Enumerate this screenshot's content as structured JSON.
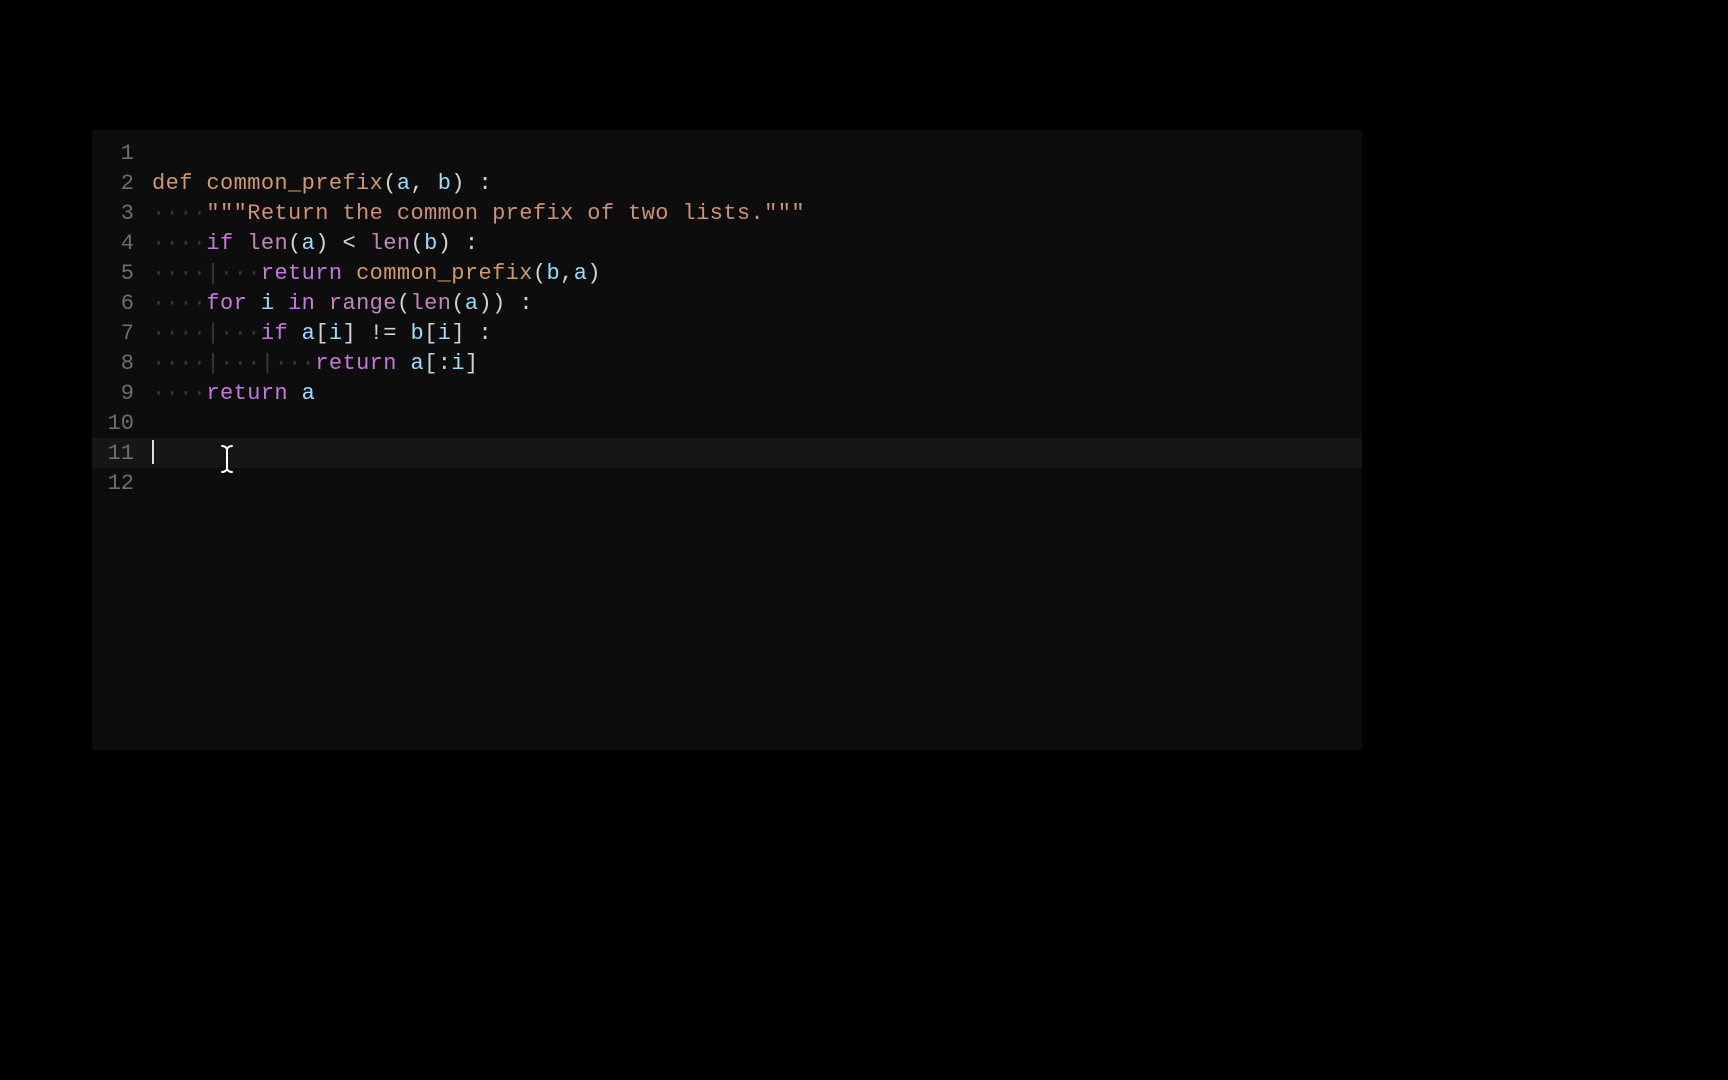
{
  "editor": {
    "cursor_line": 11,
    "lines": [
      {
        "n": 1,
        "tokens": []
      },
      {
        "n": 2,
        "tokens": [
          {
            "t": "def ",
            "c": "kw-def"
          },
          {
            "t": "common_prefix",
            "c": "fn"
          },
          {
            "t": "(",
            "c": "punct"
          },
          {
            "t": "a",
            "c": "param"
          },
          {
            "t": ", ",
            "c": "punct"
          },
          {
            "t": "b",
            "c": "param"
          },
          {
            "t": ") :",
            "c": "punct"
          }
        ]
      },
      {
        "n": 3,
        "tokens": [
          {
            "t": "····",
            "c": "ws-dot"
          },
          {
            "t": "\"\"\"Return the common prefix of two lists.\"\"\"",
            "c": "str"
          }
        ]
      },
      {
        "n": 4,
        "tokens": [
          {
            "t": "····",
            "c": "ws-dot"
          },
          {
            "t": "if ",
            "c": "kw-ctrl"
          },
          {
            "t": "len",
            "c": "builtin"
          },
          {
            "t": "(",
            "c": "punct"
          },
          {
            "t": "a",
            "c": "var"
          },
          {
            "t": ") < ",
            "c": "op"
          },
          {
            "t": "len",
            "c": "builtin"
          },
          {
            "t": "(",
            "c": "punct"
          },
          {
            "t": "b",
            "c": "var"
          },
          {
            "t": ") :",
            "c": "punct"
          }
        ]
      },
      {
        "n": 5,
        "tokens": [
          {
            "t": "····",
            "c": "ws-dot"
          },
          {
            "t": "|",
            "c": "ws-guide"
          },
          {
            "t": "···",
            "c": "ws-dot"
          },
          {
            "t": "return ",
            "c": "kw-ctrl"
          },
          {
            "t": "common_prefix",
            "c": "fn"
          },
          {
            "t": "(",
            "c": "punct"
          },
          {
            "t": "b",
            "c": "var"
          },
          {
            "t": ",",
            "c": "punct"
          },
          {
            "t": "a",
            "c": "var"
          },
          {
            "t": ")",
            "c": "punct"
          }
        ]
      },
      {
        "n": 6,
        "tokens": [
          {
            "t": "····",
            "c": "ws-dot"
          },
          {
            "t": "for ",
            "c": "kw-ctrl"
          },
          {
            "t": "i",
            "c": "var"
          },
          {
            "t": " in ",
            "c": "kw-ctrl"
          },
          {
            "t": "range",
            "c": "builtin"
          },
          {
            "t": "(",
            "c": "punct"
          },
          {
            "t": "len",
            "c": "builtin"
          },
          {
            "t": "(",
            "c": "punct"
          },
          {
            "t": "a",
            "c": "var"
          },
          {
            "t": ")) :",
            "c": "punct"
          }
        ]
      },
      {
        "n": 7,
        "tokens": [
          {
            "t": "····",
            "c": "ws-dot"
          },
          {
            "t": "|",
            "c": "ws-guide"
          },
          {
            "t": "···",
            "c": "ws-dot"
          },
          {
            "t": "if ",
            "c": "kw-ctrl"
          },
          {
            "t": "a",
            "c": "var"
          },
          {
            "t": "[",
            "c": "punct"
          },
          {
            "t": "i",
            "c": "var"
          },
          {
            "t": "] != ",
            "c": "op"
          },
          {
            "t": "b",
            "c": "var"
          },
          {
            "t": "[",
            "c": "punct"
          },
          {
            "t": "i",
            "c": "var"
          },
          {
            "t": "] :",
            "c": "punct"
          }
        ]
      },
      {
        "n": 8,
        "tokens": [
          {
            "t": "····",
            "c": "ws-dot"
          },
          {
            "t": "|",
            "c": "ws-guide"
          },
          {
            "t": "···",
            "c": "ws-dot"
          },
          {
            "t": "|",
            "c": "ws-guide"
          },
          {
            "t": "···",
            "c": "ws-dot"
          },
          {
            "t": "return ",
            "c": "kw-ctrl"
          },
          {
            "t": "a",
            "c": "var"
          },
          {
            "t": "[:",
            "c": "punct"
          },
          {
            "t": "i",
            "c": "var"
          },
          {
            "t": "]",
            "c": "punct"
          }
        ]
      },
      {
        "n": 9,
        "tokens": [
          {
            "t": "····",
            "c": "ws-dot"
          },
          {
            "t": "return ",
            "c": "kw-ctrl"
          },
          {
            "t": "a",
            "c": "var"
          }
        ]
      },
      {
        "n": 10,
        "tokens": []
      },
      {
        "n": 11,
        "tokens": [],
        "cursor": true
      },
      {
        "n": 12,
        "tokens": []
      }
    ]
  },
  "ibeam_glyph": "I"
}
